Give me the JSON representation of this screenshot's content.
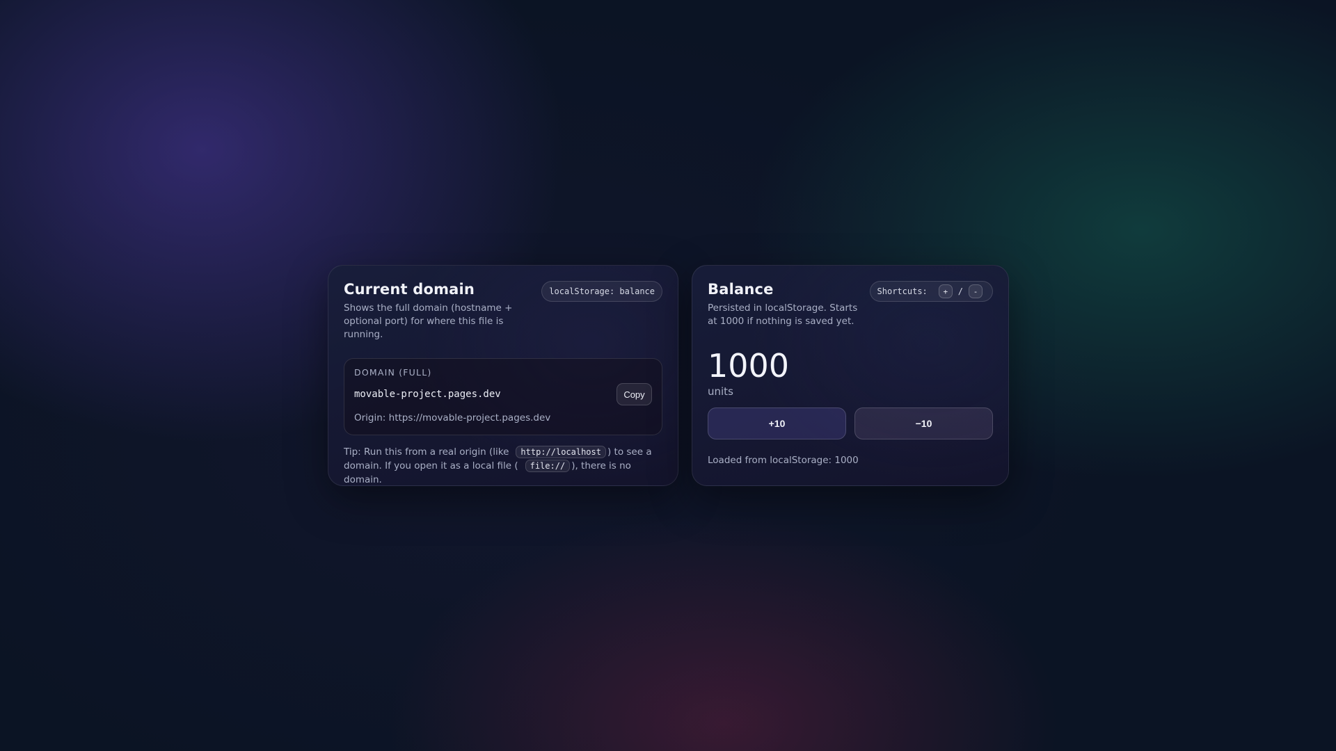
{
  "domain_card": {
    "title": "Current domain",
    "description": "Shows the full domain (hostname + optional port) for where this file is running.",
    "storage_pill": "localStorage: balance",
    "domain_label": "DOMAIN (FULL)",
    "domain_value": "movable-project.pages.dev",
    "copy_label": "Copy",
    "origin_text": "Origin: https://movable-project.pages.dev",
    "tip": {
      "part1": "Tip: Run this from a real origin (like",
      "code1": "http://localhost",
      "part2": ") to see a domain. If you open it as a local file (",
      "code2": "file://",
      "part3": "), there is no domain."
    }
  },
  "balance_card": {
    "title": "Balance",
    "description": "Persisted in localStorage. Starts at 1000 if nothing is saved yet.",
    "shortcuts_label": "Shortcuts:",
    "shortcut_plus": "+",
    "shortcut_separator": "/",
    "shortcut_minus": "-",
    "value": "1000",
    "units": "units",
    "plus_label": "+10",
    "minus_label": "−10",
    "status": "Loaded from localStorage: 1000"
  }
}
